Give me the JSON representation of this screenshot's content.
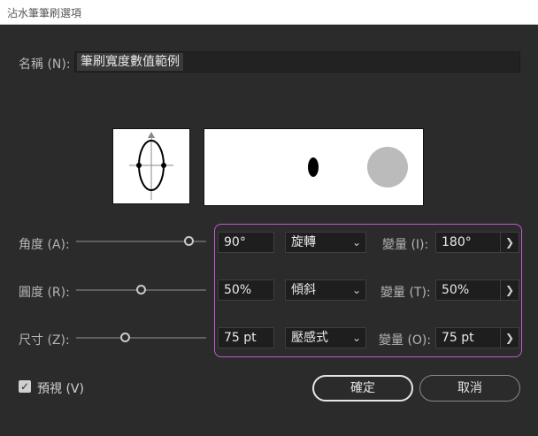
{
  "window": {
    "title": "沾水筆筆刷選項"
  },
  "name": {
    "label": "名稱 (N):",
    "value": "筆刷寬度數值範例"
  },
  "rows": [
    {
      "label": "角度 (A):",
      "value": "90°",
      "slider_fraction": 0.87,
      "mode": "旋轉",
      "variation_label": "變量 (I):",
      "variation_value": "180°"
    },
    {
      "label": "圓度 (R):",
      "value": "50%",
      "slider_fraction": 0.5,
      "mode": "傾斜",
      "variation_label": "變量 (T):",
      "variation_value": "50%"
    },
    {
      "label": "尺寸 (Z):",
      "value": "75 pt",
      "slider_fraction": 0.38,
      "mode": "壓感式",
      "variation_label": "變量 (O):",
      "variation_value": "75 pt"
    }
  ],
  "preview": {
    "small_dot_color": "#000000",
    "large_dot_color": "#bbbbbb"
  },
  "footer": {
    "preview_label": "預視 (V)",
    "preview_checked": true,
    "ok_label": "確定",
    "cancel_label": "取消"
  },
  "colors": {
    "highlight": "#c05bd0"
  }
}
